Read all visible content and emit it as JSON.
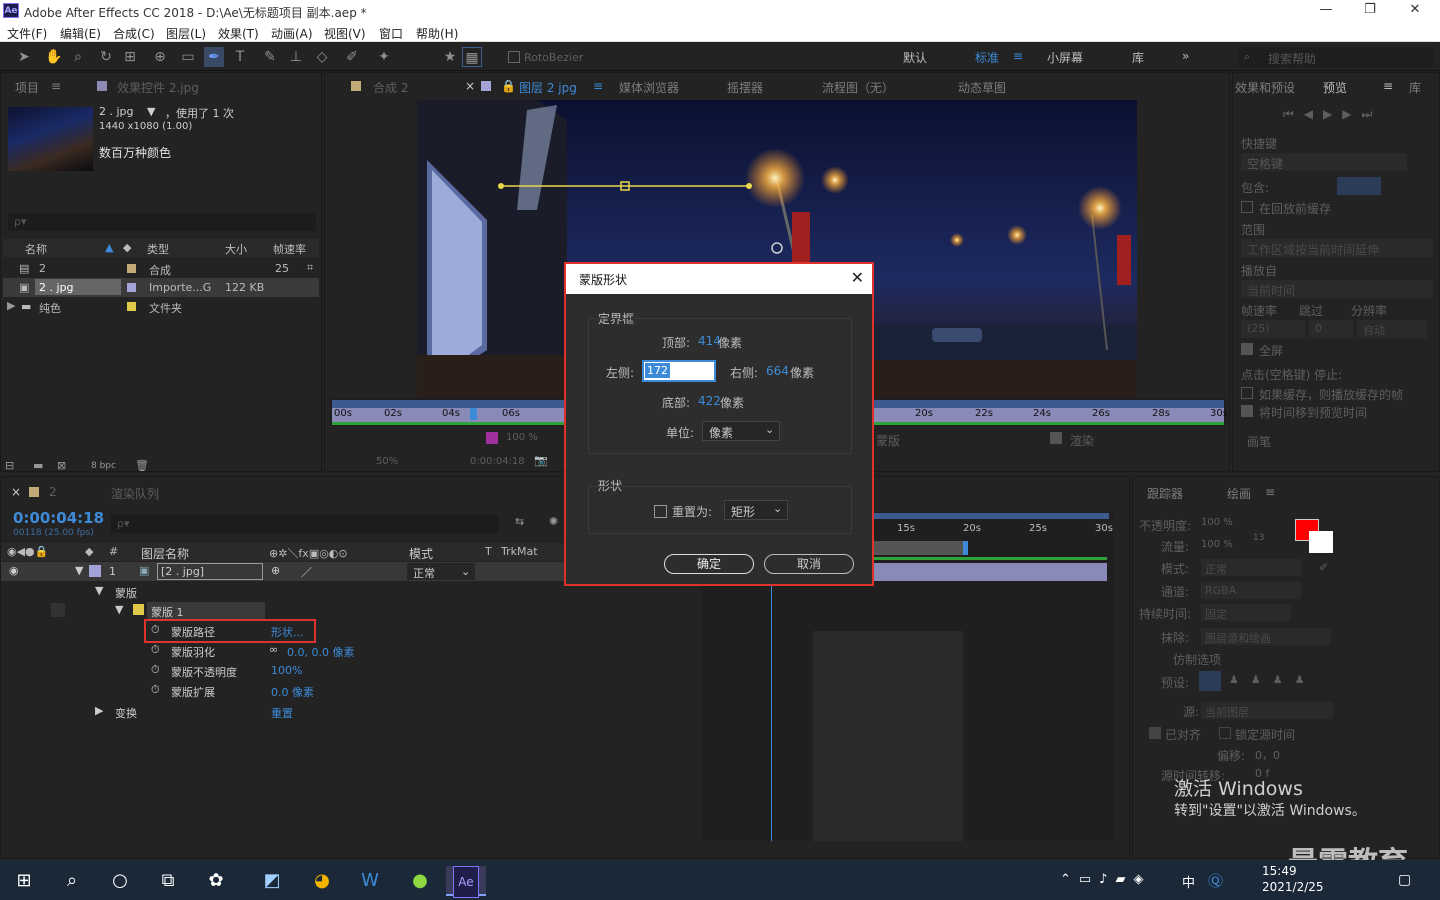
{
  "window": {
    "title": "Adobe After Effects CC 2018 - D:\\Ae\\无标题项目 副本.aep *",
    "logo": "Ae",
    "minimize": "—",
    "restore": "❐",
    "close": "✕"
  },
  "menu": [
    "文件(F)",
    "编辑(E)",
    "合成(C)",
    "图层(L)",
    "效果(T)",
    "动画(A)",
    "视图(V)",
    "窗口",
    "帮助(H)"
  ],
  "toolbar": {
    "rotobezier": "RotoBezier",
    "workspaces": [
      "默认",
      "标准",
      "小屏幕",
      "库"
    ],
    "search_placeholder": "搜索帮助"
  },
  "project_panel": {
    "tab_project": "项目",
    "tab_effects": "效果控件 2.jpg",
    "item_name": "2 . jpg",
    "used": "，使用了 1 次",
    "dims": "1440 x1080 (1.00)",
    "colors": "数百万种颜色",
    "search_placeholder": "ρ▾",
    "columns": [
      "名称",
      "类型",
      "大小",
      "帧速率"
    ],
    "rows": [
      {
        "name": "2",
        "type": "合成",
        "size": "",
        "fps": "25"
      },
      {
        "name": "2 . jpg",
        "type": "Importe...G",
        "size": "122 KB",
        "fps": ""
      },
      {
        "name": "纯色",
        "type": "文件夹",
        "size": "",
        "fps": ""
      }
    ],
    "bpc": "8 bpc"
  },
  "comp_panel": {
    "tabs": [
      "合成 2",
      "图层 2 jpg",
      "媒体浏览器",
      "摇摆器",
      "流程图（无）",
      "动态草图"
    ],
    "ruler_labels": [
      "00s",
      "02s",
      "04s",
      "06s",
      "20s",
      "22s",
      "24s",
      "26s",
      "28s",
      "30s"
    ],
    "zoom": "50%",
    "time": "0:00:04:18",
    "percent": "100 %",
    "view_option": "蒙版",
    "render_label": "渲染"
  },
  "dialog": {
    "title": "蒙版形状",
    "close": "✕",
    "bbox_group": "定界框",
    "top_label": "顶部:",
    "top_value": "414",
    "left_label": "左侧:",
    "left_value": "172",
    "right_label": "右侧:",
    "right_value": "664",
    "bottom_label": "底部:",
    "bottom_value": "422",
    "px": "像素",
    "unit_label": "单位:",
    "unit_value": "像素",
    "shape_group": "形状",
    "reset_label": "重置为:",
    "reset_value": "矩形",
    "ok": "确定",
    "cancel": "取消"
  },
  "right_panel": {
    "tabs": [
      "效果和预设",
      "预览",
      "库"
    ],
    "shortcut_label": "快捷键",
    "shortcut_value": "空格键",
    "include_label": "包含:",
    "cache_before": "在回放前缓存",
    "range_label": "范围",
    "range_value": "工作区域按当前时间延伸",
    "play_from_label": "播放自",
    "play_from_value": "当前时间",
    "fps_label": "帧速率",
    "skip_label": "跳过",
    "res_label": "分辨率",
    "fps_value": "(25)",
    "skip_value": "0",
    "res_value": "自动",
    "fullscreen": "全屏",
    "stop_label": "点击(空格键) 停止:",
    "stop_opt1": "如果缓存，则播放缓存的帧",
    "stop_opt2": "将时间移到预览时间",
    "brush_tab": "画笔"
  },
  "paint_panel": {
    "tabs": [
      "跟踪器",
      "绘画"
    ],
    "opacity_label": "不透明度:",
    "opacity_value": "100 %",
    "flow_label": "流量:",
    "flow_value": "100 %",
    "mode_label": "模式:",
    "mode_value": "正常",
    "channel_label": "通道:",
    "channel_value": "RGBA",
    "duration_label": "持续时间:",
    "duration_value": "固定",
    "erase_label": "抹除:",
    "erase_value": "图层源和绘画",
    "clone_label": "仿制选项",
    "preset_label": "预设:",
    "source_label": "源:",
    "source_value": "当前图层",
    "aligned": "已对齐",
    "lock_time": "锁定源时间",
    "offset_label": "偏移:",
    "offset_value": "0，0",
    "source_time_label": "源时间转移:",
    "source_time_value": "0 f",
    "brush_size": "13"
  },
  "timeline": {
    "tab": "2",
    "render_queue": "渲染队列",
    "timecode": "0:00:04:18",
    "frame_info": "00118 (25.00 fps)",
    "search_placeholder": "ρ▾",
    "col_layer_name": "图层名称",
    "col_mode": "模式",
    "col_t": "T",
    "col_trkmat": "TrkMat",
    "layer_num": "1",
    "layer_name": "[2 . jpg]",
    "layer_mode": "正常",
    "masks_label": "蒙版",
    "mask1_label": "蒙版 1",
    "props": [
      {
        "name": "蒙版路径",
        "value": "形状..."
      },
      {
        "name": "蒙版羽化",
        "value": "0.0, 0.0 像素"
      },
      {
        "name": "蒙版不透明度",
        "value": "100%"
      },
      {
        "name": "蒙版扩展",
        "value": "0.0 像素"
      }
    ],
    "transform_label": "变换",
    "transform_value": "重置",
    "ruler_labels": [
      "15s",
      "20s",
      "25s",
      "30s"
    ]
  },
  "activation": {
    "line1": "激活 Windows",
    "line2": "转到\"设置\"以激活 Windows。"
  },
  "watermark": "最需教育",
  "taskbar": {
    "time": "15:49",
    "date": "2021/2/25",
    "lang": "中",
    "ae_label": "Ae"
  }
}
